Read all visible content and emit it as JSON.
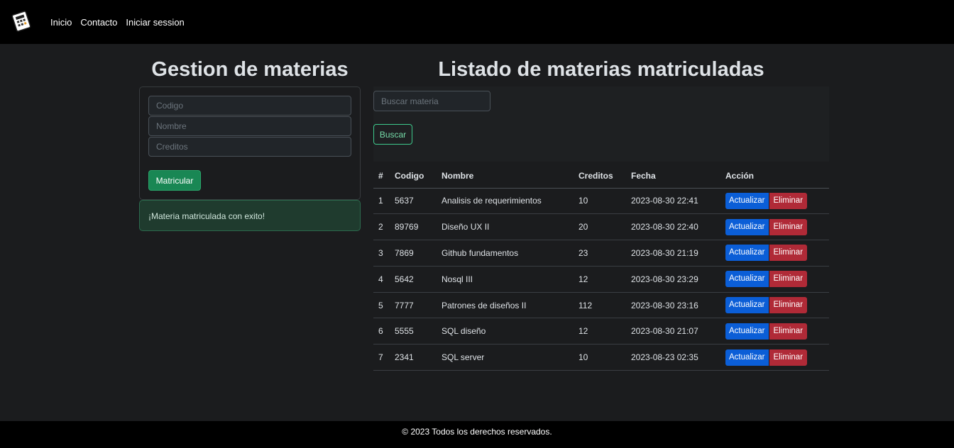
{
  "nav": {
    "brand_icon": "calculator-note-icon",
    "links": [
      "Inicio",
      "Contacto",
      "Iniciar session"
    ]
  },
  "left": {
    "title": "Gestion de materias",
    "codigo_placeholder": "Codigo",
    "nombre_placeholder": "Nombre",
    "creditos_placeholder": "Creditos",
    "submit_label": "Matricular",
    "alert": "¡Materia matriculada con exito!"
  },
  "right": {
    "title": "Listado de materias matriculadas",
    "search_placeholder": "Buscar materia",
    "search_button": "Buscar",
    "headers": [
      "#",
      "Codigo",
      "Nombre",
      "Creditos",
      "Fecha",
      "Acción"
    ],
    "update_label": "Actualizar",
    "delete_label": "Eliminar",
    "rows": [
      {
        "num": "1",
        "codigo": "5637",
        "nombre": "Analisis de requerimientos",
        "creditos": "10",
        "fecha": "2023-08-30 22:41"
      },
      {
        "num": "2",
        "codigo": "89769",
        "nombre": "Diseño UX II",
        "creditos": "20",
        "fecha": "2023-08-30 22:40"
      },
      {
        "num": "3",
        "codigo": "7869",
        "nombre": "Github fundamentos",
        "creditos": "23",
        "fecha": "2023-08-30 21:19"
      },
      {
        "num": "4",
        "codigo": "5642",
        "nombre": "Nosql III",
        "creditos": "12",
        "fecha": "2023-08-30 23:29"
      },
      {
        "num": "5",
        "codigo": "7777",
        "nombre": "Patrones de diseños II",
        "creditos": "112",
        "fecha": "2023-08-30 23:16"
      },
      {
        "num": "6",
        "codigo": "5555",
        "nombre": "SQL diseño",
        "creditos": "12",
        "fecha": "2023-08-30 21:07"
      },
      {
        "num": "7",
        "codigo": "2341",
        "nombre": "SQL server",
        "creditos": "10",
        "fecha": "2023-08-23 02:35"
      }
    ]
  },
  "footer": {
    "text": "© 2023 Todos los derechos reservados."
  },
  "colors": {
    "success": "#198754",
    "primary": "#0b5ed7",
    "danger": "#b02a37",
    "background": "#1b1c1e"
  }
}
